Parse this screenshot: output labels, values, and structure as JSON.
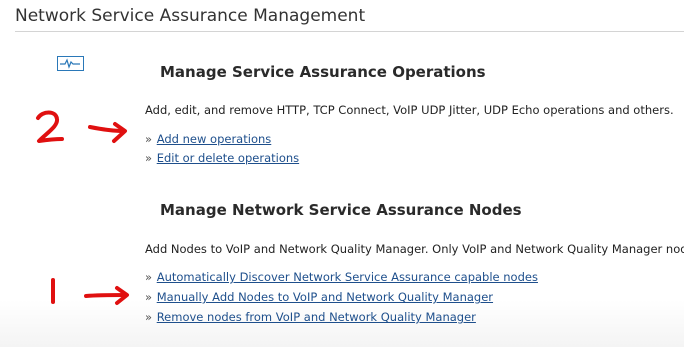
{
  "page": {
    "title": "Network Service Assurance Management"
  },
  "icons": {
    "section_icon": "pulse-monitor-icon"
  },
  "sections": [
    {
      "heading": "Manage Service Assurance Operations",
      "description": "Add, edit, and remove HTTP, TCP Connect, VoIP UDP Jitter, UDP Echo operations and others.",
      "links": [
        {
          "bullet": "»",
          "label": "Add new operations"
        },
        {
          "bullet": "»",
          "label": "Edit or delete operations"
        }
      ]
    },
    {
      "heading": "Manage Network Service Assurance Nodes",
      "description": "Add Nodes to VoIP and Network Quality Manager. Only VoIP and Network Quality Manager nodes",
      "links": [
        {
          "bullet": "»",
          "label": "Automatically Discover Network Service Assurance capable nodes"
        },
        {
          "bullet": "»",
          "label": "Manually Add Nodes to VoIP and Network Quality Manager"
        },
        {
          "bullet": "»",
          "label": "Remove nodes from VoIP and Network Quality Manager"
        }
      ]
    }
  ],
  "annotations": {
    "step_two": "2",
    "step_one": "1",
    "color": "#e01010"
  },
  "colors": {
    "link": "#1e4f8c",
    "rule": "#d4d4d4",
    "icon": "#2a78b8"
  }
}
